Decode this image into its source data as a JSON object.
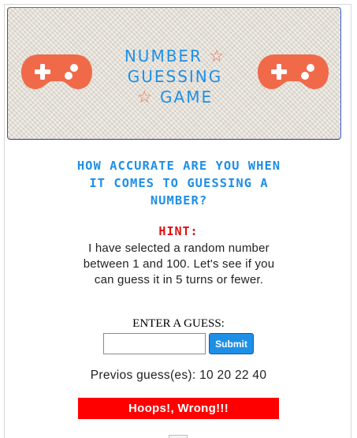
{
  "header": {
    "title_line1": "NUMBER",
    "title_line2": "GUESSING",
    "title_line3": "GAME",
    "star_glyph": "☆",
    "icon_left": "gamepad-icon",
    "icon_right": "gamepad-icon"
  },
  "intro": {
    "question": "HOW ACCURATE ARE YOU WHEN IT COMES TO GUESSING A NUMBER?",
    "hint_label": "HINT:",
    "hint_text": "I have selected a random number between 1 and 100. Let's see if you can guess it in 5 turns or fewer."
  },
  "form": {
    "label": "ENTER A GUESS:",
    "input_value": "",
    "submit_label": "Submit"
  },
  "status": {
    "previous_guesses": "Previos guess(es): 10 20 22 40",
    "result": "Hoops!, Wrong!!!"
  },
  "colors": {
    "accent_blue": "#1e8fe6",
    "gamepad": "#f06a4a",
    "hint_red": "#e01010",
    "result_bg": "#ff0000",
    "banner_bg": "#e6e0d6"
  }
}
